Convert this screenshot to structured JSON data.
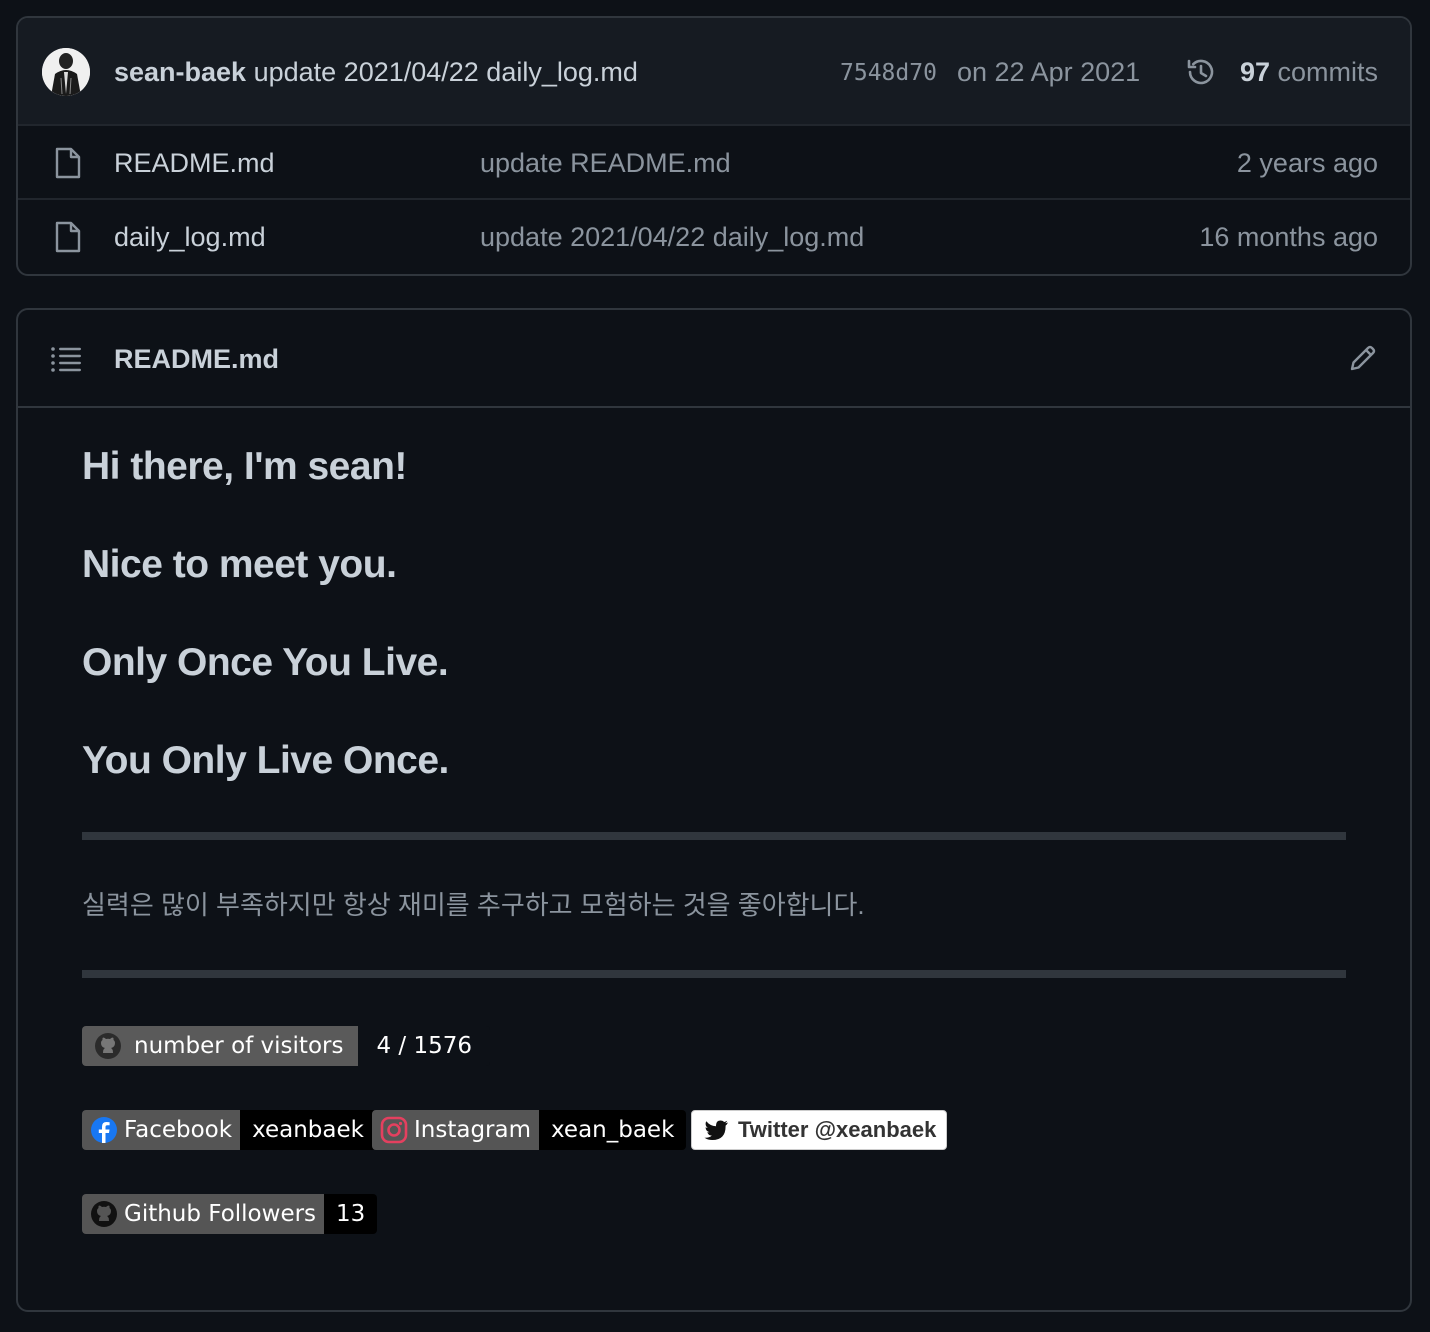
{
  "latest_commit": {
    "author": "sean-baek",
    "message": "update 2021/04/22 daily_log.md",
    "sha": "7548d70",
    "date": "on 22 Apr 2021",
    "commit_count": "97",
    "commit_label": "commits"
  },
  "files": [
    {
      "name": "README.md",
      "message": "update README.md",
      "age": "2 years ago",
      "icon": "file-icon"
    },
    {
      "name": "daily_log.md",
      "message": "update 2021/04/22 daily_log.md",
      "age": "16 months ago",
      "icon": "file-icon"
    }
  ],
  "readme": {
    "title": "README.md",
    "headings": [
      "Hi there, I'm sean!",
      "Nice to meet you.",
      "Only Once You Live.",
      "You Only Live Once."
    ],
    "intro": "실력은 많이 부족하지만 항상 재미를 추구하고 모험하는 것을 좋아합니다.",
    "badges": {
      "visitors": {
        "label": "number of visitors",
        "value": "4 / 1576"
      },
      "facebook": {
        "label": "Facebook",
        "value": "xeanbaek"
      },
      "instagram": {
        "label": "Instagram",
        "value": "xean_baek"
      },
      "twitter": {
        "label": "Twitter @xeanbaek"
      },
      "github": {
        "label": "Github Followers",
        "value": "13"
      }
    }
  },
  "colors": {
    "background": "#0d1117",
    "header_background": "#161b22",
    "border": "#30363d",
    "text_primary": "#c9d1d9",
    "text_muted": "#8b949e"
  }
}
